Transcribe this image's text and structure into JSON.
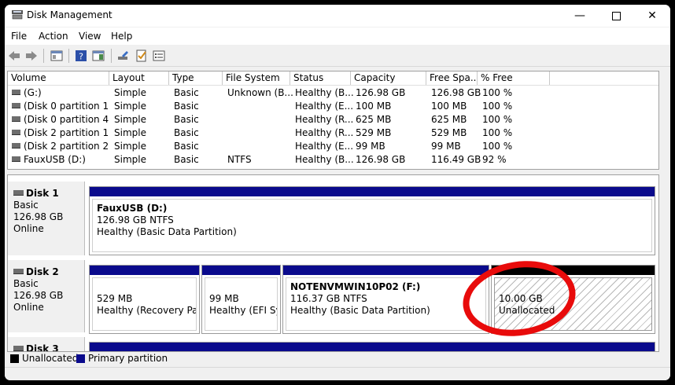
{
  "window": {
    "title": "Disk Management"
  },
  "menu": {
    "file": "File",
    "action": "Action",
    "view": "View",
    "help": "Help"
  },
  "volume_list": {
    "columns": [
      "Volume",
      "Layout",
      "Type",
      "File System",
      "Status",
      "Capacity",
      "Free Spa...",
      "% Free"
    ],
    "rows": [
      [
        "(G:)",
        "Simple",
        "Basic",
        "Unknown (B...",
        "Healthy (B...",
        "126.98 GB",
        "126.98 GB",
        "100 %"
      ],
      [
        "(Disk 0 partition 1)",
        "Simple",
        "Basic",
        "",
        "Healthy (E...",
        "100 MB",
        "100 MB",
        "100 %"
      ],
      [
        "(Disk 0 partition 4)",
        "Simple",
        "Basic",
        "",
        "Healthy (R...",
        "625 MB",
        "625 MB",
        "100 %"
      ],
      [
        "(Disk 2 partition 1)",
        "Simple",
        "Basic",
        "",
        "Healthy (R...",
        "529 MB",
        "529 MB",
        "100 %"
      ],
      [
        "(Disk 2 partition 2)",
        "Simple",
        "Basic",
        "",
        "Healthy (E...",
        "99 MB",
        "99 MB",
        "100 %"
      ],
      [
        "FauxUSB (D:)",
        "Simple",
        "Basic",
        "NTFS",
        "Healthy (B...",
        "126.98 GB",
        "116.49 GB",
        "92 %"
      ]
    ]
  },
  "disks": [
    {
      "name": "Disk 1",
      "type": "Basic",
      "size": "126.98 GB",
      "state": "Online",
      "partitions": [
        {
          "name": "FauxUSB  (D:)",
          "line1": "126.98 GB NTFS",
          "line2": "Healthy (Basic Data Partition)"
        }
      ]
    },
    {
      "name": "Disk 2",
      "type": "Basic",
      "size": "126.98 GB",
      "state": "Online",
      "partitions": [
        {
          "line1": "529 MB",
          "line2": "Healthy (Recovery Partit"
        },
        {
          "line1": "99 MB",
          "line2": "Healthy (EFI Syst"
        },
        {
          "name": "NOTENVMWIN10P02  (F:)",
          "line1": "116.37 GB NTFS",
          "line2": "Healthy (Basic Data Partition)"
        },
        {
          "line1": "10.00 GB",
          "line2": "Unallocated"
        }
      ]
    },
    {
      "name": "Disk 3"
    }
  ],
  "legend": {
    "unallocated": "Unallocated",
    "primary": "Primary partition"
  },
  "colors": {
    "primary_partition": "#0a0a8c",
    "unallocated": "#000000",
    "highlight_circle": "#e80b0b"
  }
}
